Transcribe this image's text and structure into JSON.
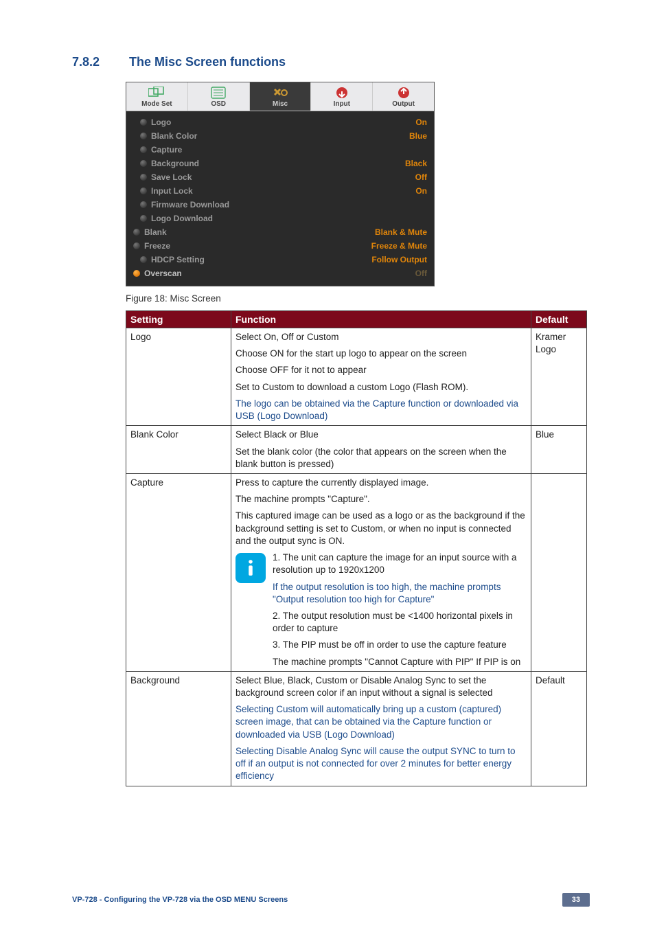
{
  "heading": {
    "number": "7.8.2",
    "title": "The Misc Screen functions"
  },
  "osd": {
    "tabs": [
      {
        "label": "Mode Set"
      },
      {
        "label": "OSD"
      },
      {
        "label": "Misc"
      },
      {
        "label": "Input"
      },
      {
        "label": "Output"
      }
    ],
    "rows": [
      {
        "label": "Logo",
        "value": "On",
        "sub": true
      },
      {
        "label": "Blank Color",
        "value": "Blue",
        "sub": true
      },
      {
        "label": "Capture",
        "value": "",
        "sub": true
      },
      {
        "label": "Background",
        "value": "Black",
        "sub": true
      },
      {
        "label": "Save Lock",
        "value": "Off",
        "sub": true
      },
      {
        "label": "Input Lock",
        "value": "On",
        "sub": true
      },
      {
        "label": "Firmware Download",
        "value": "",
        "sub": true
      },
      {
        "label": "Logo Download",
        "value": "",
        "sub": true
      },
      {
        "label": "Blank",
        "value": "Blank & Mute",
        "sub": false
      },
      {
        "label": "Freeze",
        "value": "Freeze & Mute",
        "sub": false
      },
      {
        "label": "HDCP Setting",
        "value": "Follow Output",
        "sub": true
      },
      {
        "label": "Overscan",
        "value": "Off",
        "sub": false,
        "selected": true,
        "dimValue": true
      }
    ]
  },
  "caption": "Figure 18: Misc Screen",
  "table": {
    "headers": {
      "c1": "Setting",
      "c2": "Function",
      "c3": "Default"
    },
    "rows": {
      "logo": {
        "name": "Logo",
        "fn_l1": "Select On, Off or Custom",
        "fn_l2": "Choose ON for the start up logo to appear on the screen",
        "fn_l3": "Choose OFF for it not to appear",
        "fn_l4": "Set to Custom to download a custom Logo (Flash ROM).",
        "fn_note": "The logo can be obtained via the Capture function or downloaded via USB (Logo Download)",
        "def": "Kramer Logo"
      },
      "blank": {
        "name": "Blank Color",
        "fn_l1": "Select Black or Blue",
        "fn_l2": "Set the blank color (the color that appears on the screen when the blank button is pressed)",
        "def": "Blue"
      },
      "capture": {
        "name": "Capture",
        "fn_l1": "Press to capture the currently displayed image.",
        "fn_l2": "The machine prompts \"Capture\".",
        "fn_l3": "This captured image can be used as a logo or as the background if the background setting is set to Custom, or when no input is connected and the output sync is ON.",
        "info1": "1. The unit can capture the image for an input source with a resolution up to 1920x1200",
        "info_note": "If the output resolution is too high, the machine prompts \"Output resolution too high for Capture\"",
        "info2": "2. The output resolution must be <1400 horizontal pixels in order to capture",
        "info3": "3. The PIP must be off in order to use the capture feature",
        "info4": "The machine prompts \"Cannot Capture with PIP\" If PIP is on",
        "def": ""
      },
      "bg": {
        "name": "Background",
        "fn_l1": "Select Blue, Black, Custom or Disable Analog Sync to set the background screen color if an input without a signal is selected",
        "fn_note1": "Selecting Custom will automatically bring up a custom (captured) screen image, that can be obtained via the Capture function or downloaded via USB (Logo Download)",
        "fn_note2": "Selecting Disable Analog Sync will cause the output SYNC to turn to off if an output is not connected for over 2 minutes for better energy efficiency",
        "def": "Default"
      }
    }
  },
  "footer": {
    "left": "VP-728 - Configuring the VP-728 via the OSD MENU Screens",
    "page": "33"
  }
}
